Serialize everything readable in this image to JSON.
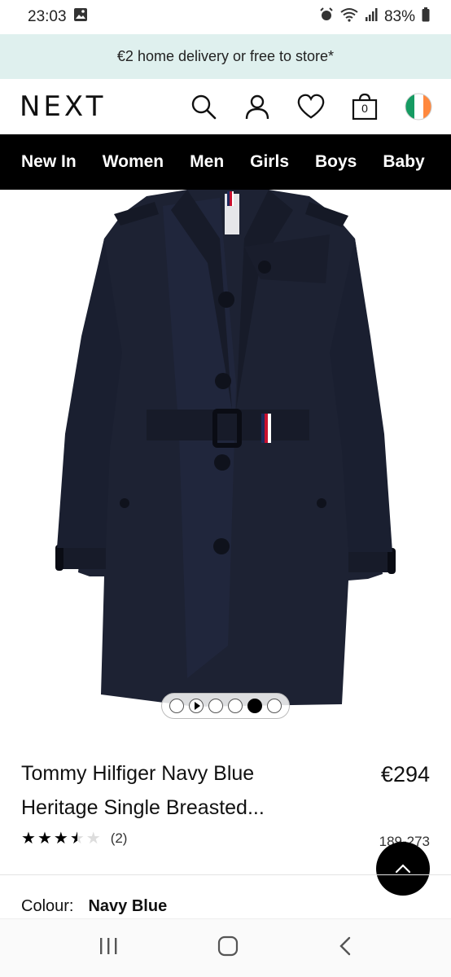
{
  "status_bar": {
    "time": "23:03",
    "battery": "83%"
  },
  "promo": {
    "text": "€2 home delivery or free to store*"
  },
  "header": {
    "logo": "NEXT",
    "bag_count": "0"
  },
  "nav": {
    "items": [
      "New In",
      "Women",
      "Men",
      "Girls",
      "Boys",
      "Baby"
    ]
  },
  "gallery": {
    "dot_count": 6,
    "active_index": 4
  },
  "product": {
    "title_line1": "Tommy Hilfiger Navy Blue",
    "title_line2": "Heritage Single Breasted...",
    "price": "€294",
    "rating_value": 3.5,
    "rating_max": 5,
    "review_count": "(2)",
    "item_number": "189-273",
    "colour_label": "Colour:",
    "colour_value": "Navy Blue"
  },
  "colors": {
    "promo_bg": "#dff0ee",
    "nav_bg": "#000000",
    "coat": "#1d2233"
  }
}
